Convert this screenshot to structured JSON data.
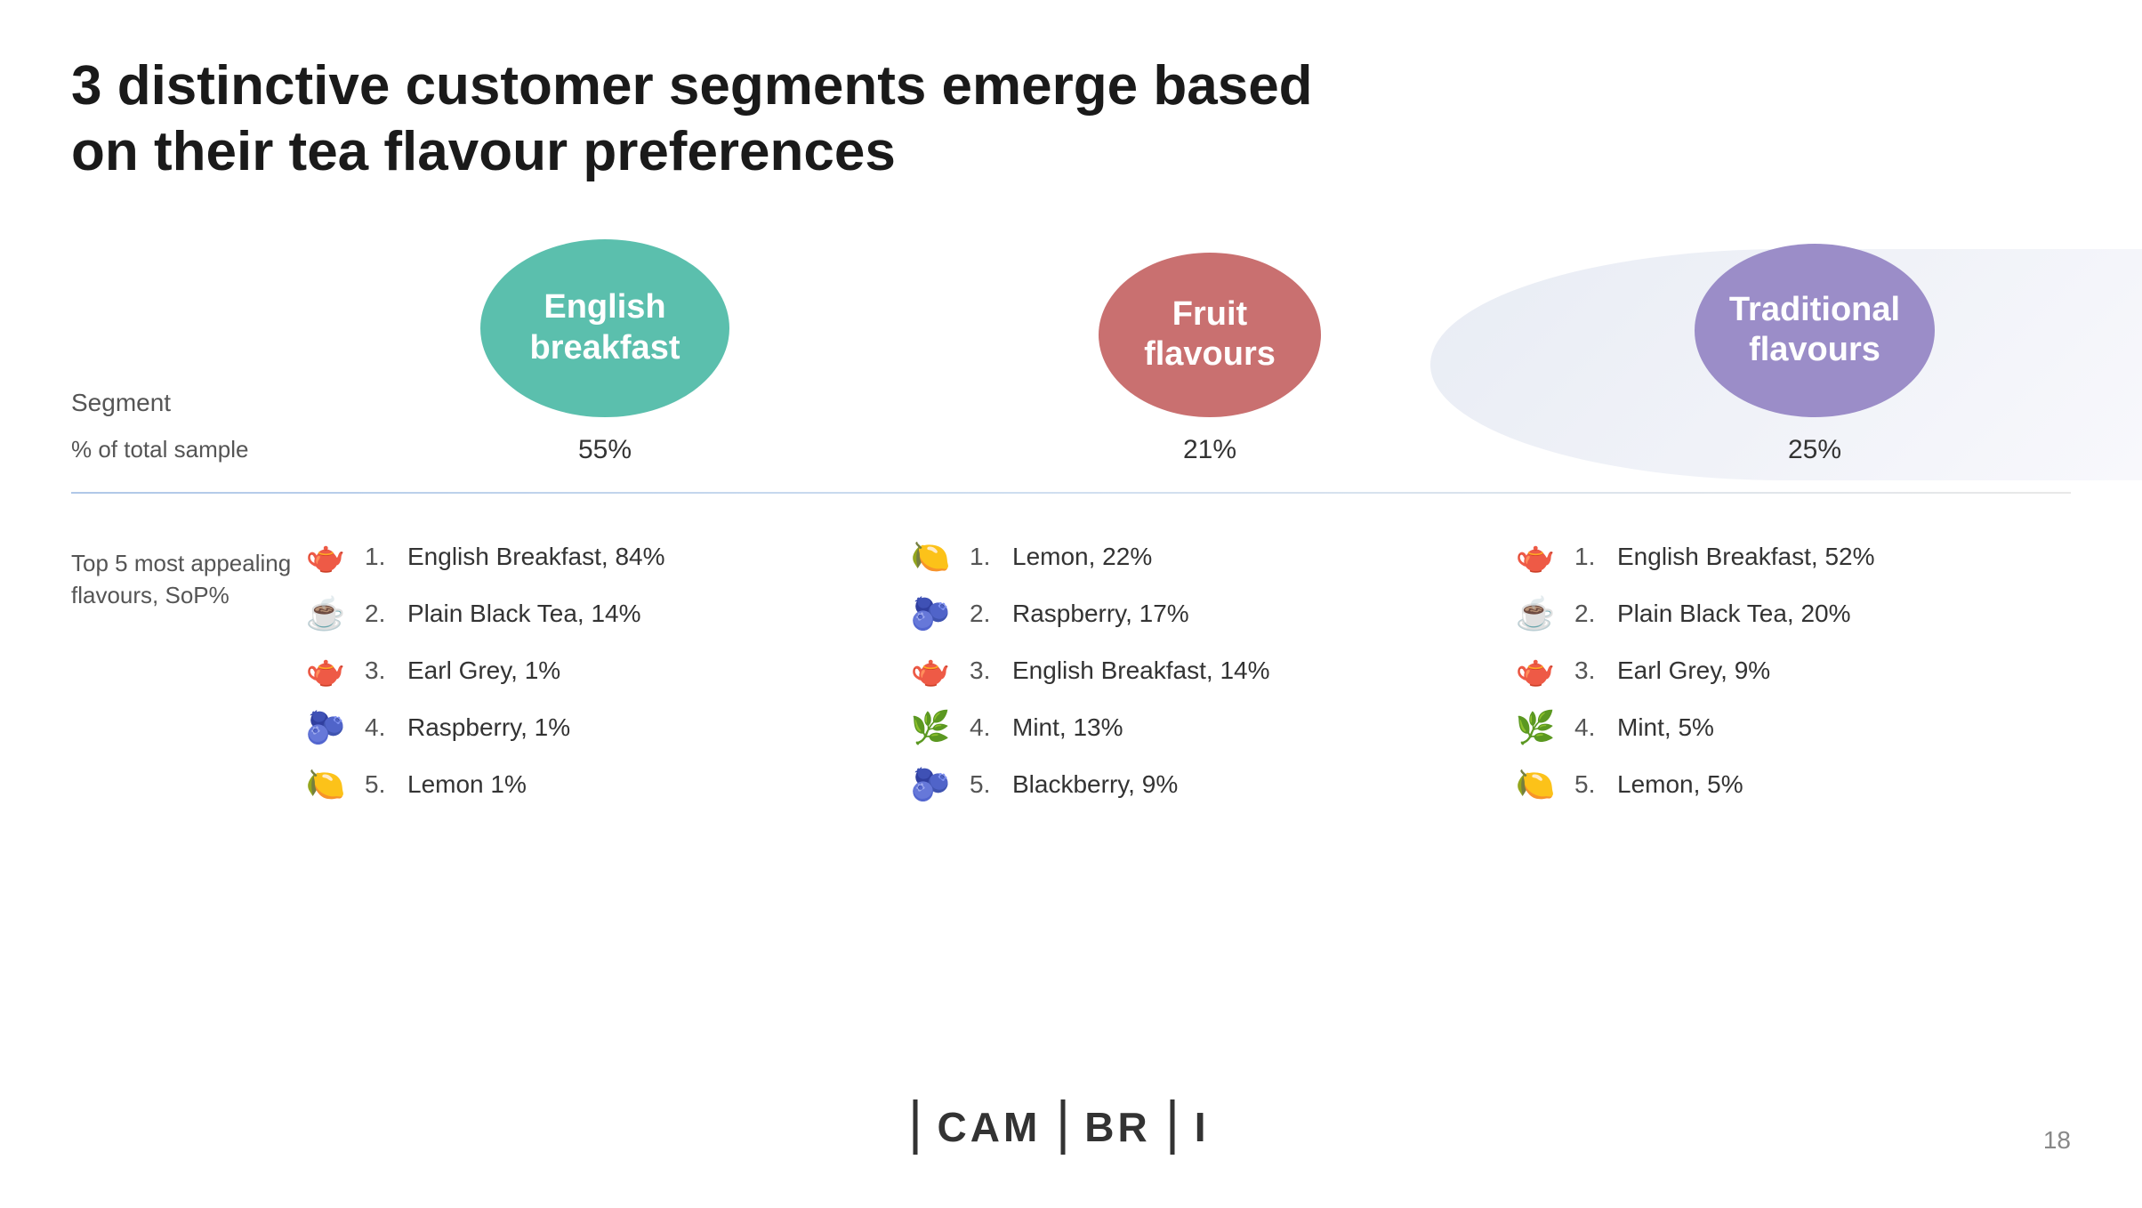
{
  "title": "3 distinctive customer segments emerge based on their tea flavour preferences",
  "segment_label": "Segment",
  "pct_label": "% of total sample",
  "flavours_label": "Top 5 most appealing flavours, SoP%",
  "segments": [
    {
      "name": "English\nbreakfast",
      "pct": "55%",
      "color": "#5bbfad",
      "flavours": [
        {
          "num": "1.",
          "icon": "🫖",
          "text": "English Breakfast, 84%"
        },
        {
          "num": "2.",
          "icon": "☕",
          "text": "Plain Black Tea, 14%"
        },
        {
          "num": "3.",
          "icon": "🫖",
          "text": "Earl Grey, 1%"
        },
        {
          "num": "4.",
          "icon": "🫐",
          "text": "Raspberry, 1%"
        },
        {
          "num": "5.",
          "icon": "🍋",
          "text": "Lemon 1%"
        }
      ]
    },
    {
      "name": "Fruit\nflavours",
      "pct": "21%",
      "color": "#c97070",
      "flavours": [
        {
          "num": "1.",
          "icon": "🍋",
          "text": "Lemon, 22%"
        },
        {
          "num": "2.",
          "icon": "🫐",
          "text": "Raspberry, 17%"
        },
        {
          "num": "3.",
          "icon": "🫖",
          "text": "English Breakfast, 14%"
        },
        {
          "num": "4.",
          "icon": "🌿",
          "text": "Mint, 13%"
        },
        {
          "num": "5.",
          "icon": "🫐",
          "text": "Blackberry, 9%"
        }
      ]
    },
    {
      "name": "Traditional\nflavours",
      "pct": "25%",
      "color": "#9b8dc8",
      "flavours": [
        {
          "num": "1.",
          "icon": "🫖",
          "text": "English Breakfast, 52%"
        },
        {
          "num": "2.",
          "icon": "☕",
          "text": "Plain Black Tea, 20%"
        },
        {
          "num": "3.",
          "icon": "🫖",
          "text": "Earl Grey, 9%"
        },
        {
          "num": "4.",
          "icon": "🌿",
          "text": "Mint, 5%"
        },
        {
          "num": "5.",
          "icon": "🍋",
          "text": "Lemon, 5%"
        }
      ]
    }
  ],
  "footer_logo": "CAM|BR|I",
  "page_number": "18"
}
